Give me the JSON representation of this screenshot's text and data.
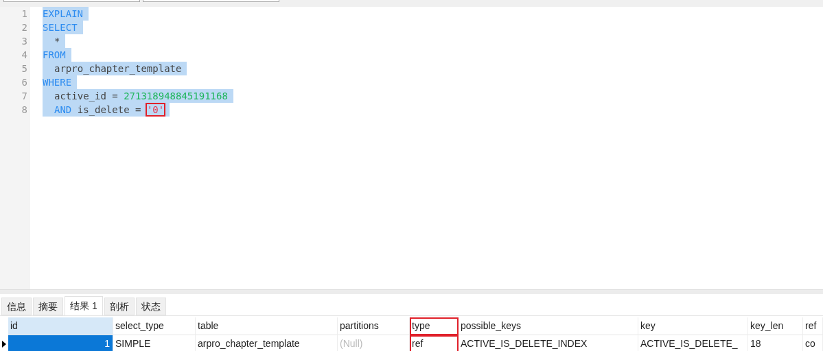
{
  "editor": {
    "lines": [
      {
        "number": "1",
        "selected": true,
        "tokens": [
          {
            "kind": "keyword",
            "text": "EXPLAIN"
          }
        ]
      },
      {
        "number": "2",
        "selected": true,
        "tokens": [
          {
            "kind": "keyword",
            "text": "SELECT"
          }
        ]
      },
      {
        "number": "3",
        "selected": true,
        "indented": true,
        "tokens": [
          {
            "kind": "plain",
            "text": "*"
          }
        ]
      },
      {
        "number": "4",
        "selected": true,
        "tokens": [
          {
            "kind": "keyword",
            "text": "FROM"
          }
        ]
      },
      {
        "number": "5",
        "selected": true,
        "indented": true,
        "tokens": [
          {
            "kind": "plain",
            "text": "arpro_chapter_template"
          }
        ]
      },
      {
        "number": "6",
        "selected": true,
        "tokens": [
          {
            "kind": "keyword",
            "text": "WHERE"
          }
        ]
      },
      {
        "number": "7",
        "selected": true,
        "indented": true,
        "tokens": [
          {
            "kind": "plain",
            "text": "active_id = "
          },
          {
            "kind": "number",
            "text": "271318948845191168"
          }
        ]
      },
      {
        "number": "8",
        "selected": true,
        "indented": true,
        "tokens": [
          {
            "kind": "keyword",
            "text": "AND"
          },
          {
            "kind": "plain",
            "text": " is_delete = "
          },
          {
            "kind": "string",
            "text": "'0'",
            "highlighted": true
          }
        ]
      }
    ]
  },
  "tabs": [
    {
      "label": "信息",
      "selected": false
    },
    {
      "label": "摘要",
      "selected": false
    },
    {
      "label": "结果 1",
      "selected": true
    },
    {
      "label": "剖析",
      "selected": false
    },
    {
      "label": "状态",
      "selected": false
    }
  ],
  "grid": {
    "columns": [
      {
        "label": "id",
        "highlighted": false
      },
      {
        "label": "select_type",
        "highlighted": false
      },
      {
        "label": "table",
        "highlighted": false
      },
      {
        "label": "partitions",
        "highlighted": false
      },
      {
        "label": "type",
        "highlighted": true
      },
      {
        "label": "possible_keys",
        "highlighted": false
      },
      {
        "label": "key",
        "highlighted": false
      },
      {
        "label": "key_len",
        "highlighted": false
      },
      {
        "label": "ref",
        "highlighted": false
      }
    ],
    "rows": [
      {
        "selected": true,
        "cells": [
          {
            "kind": "number",
            "text": "1"
          },
          {
            "kind": "text",
            "text": "SIMPLE"
          },
          {
            "kind": "text",
            "text": "arpro_chapter_template"
          },
          {
            "kind": "null",
            "text": "(Null)"
          },
          {
            "kind": "text",
            "text": "ref"
          },
          {
            "kind": "text",
            "text": "ACTIVE_IS_DELETE_INDEX"
          },
          {
            "kind": "text",
            "text": "ACTIVE_IS_DELETE_"
          },
          {
            "kind": "text",
            "text": "18"
          },
          {
            "kind": "text",
            "text": "co"
          }
        ]
      }
    ]
  }
}
